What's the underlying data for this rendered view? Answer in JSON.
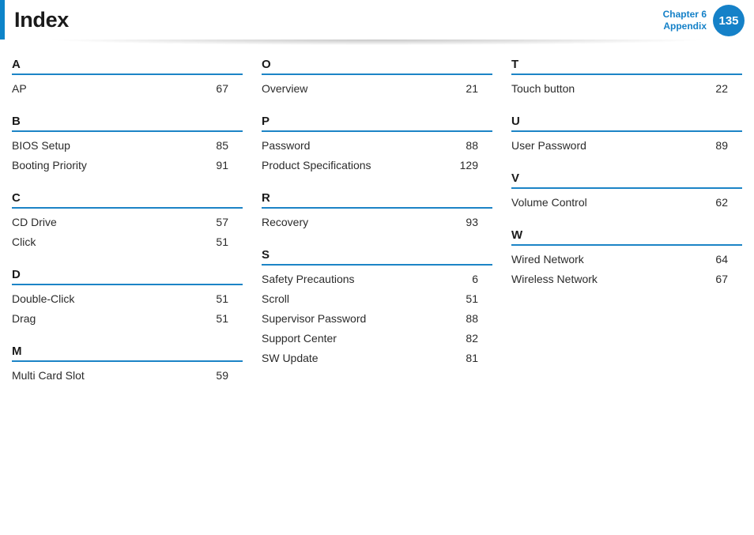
{
  "header": {
    "title": "Index",
    "chapter_line1": "Chapter 6",
    "chapter_line2": "Appendix",
    "page_number": "135",
    "accent_color": "#0d84c9",
    "rule_color": "#1c84c6",
    "badge_color": "#1581c8"
  },
  "columns": [
    {
      "groups": [
        {
          "letter": "A",
          "entries": [
            {
              "label": "AP",
              "page": "67"
            }
          ]
        },
        {
          "letter": "B",
          "entries": [
            {
              "label": "BIOS Setup",
              "page": "85"
            },
            {
              "label": "Booting Priority",
              "page": "91"
            }
          ]
        },
        {
          "letter": "C",
          "entries": [
            {
              "label": "CD Drive",
              "page": "57"
            },
            {
              "label": "Click",
              "page": "51"
            }
          ]
        },
        {
          "letter": "D",
          "entries": [
            {
              "label": "Double-Click",
              "page": "51"
            },
            {
              "label": "Drag",
              "page": "51"
            }
          ]
        },
        {
          "letter": "M",
          "entries": [
            {
              "label": "Multi Card Slot",
              "page": "59"
            }
          ]
        }
      ]
    },
    {
      "groups": [
        {
          "letter": "O",
          "entries": [
            {
              "label": "Overview",
              "page": "21"
            }
          ]
        },
        {
          "letter": "P",
          "entries": [
            {
              "label": "Password",
              "page": "88"
            },
            {
              "label": "Product Specifications",
              "page": "129"
            }
          ]
        },
        {
          "letter": "R",
          "entries": [
            {
              "label": "Recovery",
              "page": "93"
            }
          ]
        },
        {
          "letter": "S",
          "entries": [
            {
              "label": "Safety Precautions",
              "page": "6"
            },
            {
              "label": "Scroll",
              "page": "51"
            },
            {
              "label": "Supervisor Password",
              "page": "88"
            },
            {
              "label": "Support Center",
              "page": "82"
            },
            {
              "label": "SW Update",
              "page": "81"
            }
          ]
        }
      ]
    },
    {
      "groups": [
        {
          "letter": "T",
          "entries": [
            {
              "label": "Touch button",
              "page": "22"
            }
          ]
        },
        {
          "letter": "U",
          "entries": [
            {
              "label": "User Password",
              "page": "89"
            }
          ]
        },
        {
          "letter": "V",
          "entries": [
            {
              "label": "Volume Control",
              "page": "62"
            }
          ]
        },
        {
          "letter": "W",
          "entries": [
            {
              "label": "Wired Network",
              "page": "64"
            },
            {
              "label": "Wireless Network",
              "page": "67"
            }
          ]
        }
      ]
    }
  ]
}
